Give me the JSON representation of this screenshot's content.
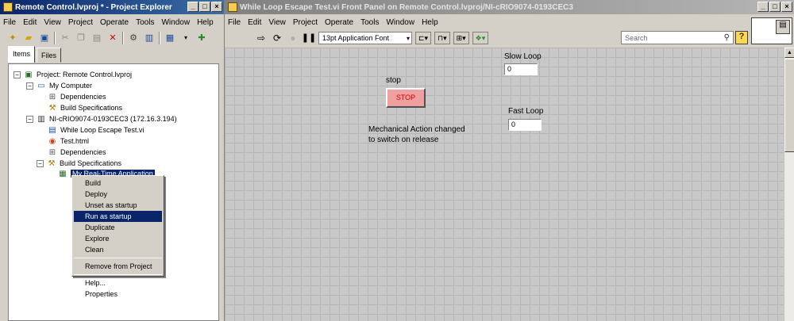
{
  "project_explorer": {
    "title": "Remote Control.lvproj * - Project Explorer",
    "menu": [
      "File",
      "Edit",
      "View",
      "Project",
      "Operate",
      "Tools",
      "Window",
      "Help"
    ],
    "tabs": [
      {
        "label": "Items",
        "selected": true
      },
      {
        "label": "Files",
        "selected": false
      }
    ],
    "tree": [
      {
        "label": "Project: Remote Control.lvproj",
        "icon": "project-icon",
        "expander": "−"
      },
      {
        "label": "My Computer",
        "icon": "computer-icon",
        "expander": "−"
      },
      {
        "label": "Dependencies",
        "icon": "dependencies-icon",
        "expander": ""
      },
      {
        "label": "Build Specifications",
        "icon": "build-specs-icon",
        "expander": ""
      },
      {
        "label": "NI-cRIO9074-0193CEC3 (172.16.3.194)",
        "icon": "target-icon",
        "expander": "−"
      },
      {
        "label": "While Loop Escape Test.vi",
        "icon": "vi-icon",
        "expander": ""
      },
      {
        "label": "Test.html",
        "icon": "html-icon",
        "expander": ""
      },
      {
        "label": "Dependencies",
        "icon": "dependencies-icon",
        "expander": ""
      },
      {
        "label": "Build Specifications",
        "icon": "build-specs-icon",
        "expander": "−"
      },
      {
        "label": "My Real-Time Application",
        "icon": "rt-app-icon",
        "expander": "",
        "selected": true
      }
    ],
    "context_menu": {
      "group1": [
        "Build",
        "Deploy",
        "Unset as startup",
        "Run as startup",
        "Duplicate",
        "Explore",
        "Clean"
      ],
      "highlighted": "Run as startup",
      "group2": [
        "Remove from Project"
      ],
      "group3": [
        "Help...",
        "Properties"
      ]
    }
  },
  "front_panel": {
    "title": "While Loop Escape Test.vi Front Panel on Remote Control.lvproj/NI-cRIO9074-0193CEC3",
    "menu": [
      "File",
      "Edit",
      "View",
      "Project",
      "Operate",
      "Tools",
      "Window",
      "Help"
    ],
    "font_selector": "13pt Application Font",
    "search_placeholder": "Search",
    "controls": {
      "stop_label": "stop",
      "stop_button_text": "STOP",
      "slow_loop_label": "Slow Loop",
      "slow_loop_value": "0",
      "fast_loop_label": "Fast Loop",
      "fast_loop_value": "0",
      "note_line1": "Mechanical Action changed",
      "note_line2": "to switch on release"
    }
  },
  "colors": {
    "active_title": "#0a246a",
    "selection": "#0a246a",
    "stop_button_fill": "#f0a0a0",
    "stop_button_text": "#d00000",
    "canvas_bg": "#c8c8c8"
  }
}
